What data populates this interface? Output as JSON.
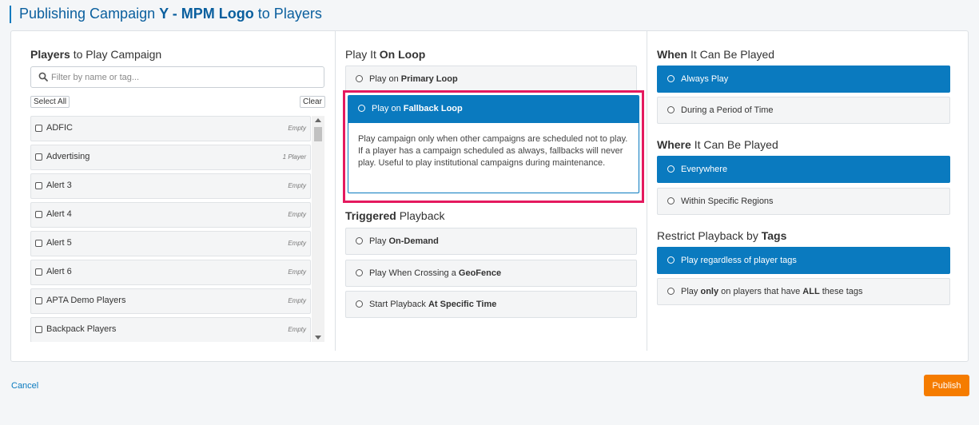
{
  "header": {
    "title_prefix": "Publishing Campaign",
    "campaign_name": "Y - MPM Logo",
    "title_suffix": "to Players"
  },
  "players": {
    "title_bold": "Players",
    "title_rest": "to Play Campaign",
    "search_placeholder": "Filter by name or tag...",
    "select_all_label": "Select All",
    "clear_label": "Clear",
    "items": [
      {
        "name": "ADFIC",
        "count": "Empty"
      },
      {
        "name": "Advertising",
        "count": "1 Player"
      },
      {
        "name": "Alert 3",
        "count": "Empty"
      },
      {
        "name": "Alert 4",
        "count": "Empty"
      },
      {
        "name": "Alert 5",
        "count": "Empty"
      },
      {
        "name": "Alert 6",
        "count": "Empty"
      },
      {
        "name": "APTA Demo Players",
        "count": "Empty"
      },
      {
        "name": "Backpack Players",
        "count": "Empty"
      }
    ]
  },
  "loop": {
    "title_prefix": "Play It",
    "title_bold": "On Loop",
    "primary": {
      "prefix": "Play on",
      "bold": "Primary Loop"
    },
    "fallback": {
      "prefix": "Play on",
      "bold": "Fallback Loop",
      "description": "Play campaign only when other campaigns are scheduled not to play. If a player has a campaign scheduled as always, fallbacks will never play. Useful to play institutional campaigns during maintenance."
    }
  },
  "triggered": {
    "title_bold": "Triggered",
    "title_rest": "Playback",
    "on_demand": {
      "prefix": "Play",
      "bold": "On-Demand"
    },
    "geofence": {
      "prefix": "Play When Crossing a",
      "bold": "GeoFence"
    },
    "specific_time": {
      "prefix": "Start Playback",
      "bold": "At Specific Time"
    }
  },
  "when": {
    "title_bold": "When",
    "title_rest": "It Can Be Played",
    "always": "Always Play",
    "period": "During a Period of Time"
  },
  "where": {
    "title_bold": "Where",
    "title_rest": "It Can Be Played",
    "everywhere": "Everywhere",
    "regions": "Within Specific Regions"
  },
  "tags": {
    "title_prefix": "Restrict Playback by",
    "title_bold": "Tags",
    "regardless": "Play regardless of player tags",
    "only_p1": "Play",
    "only_b1": "only",
    "only_p2": "on players that have",
    "only_b2": "ALL",
    "only_p3": "these tags"
  },
  "footer": {
    "cancel_label": "Cancel",
    "publish_label": "Publish"
  },
  "colors": {
    "primary": "#0a7abf",
    "highlight": "#e5195e",
    "publish": "#f57c00"
  }
}
